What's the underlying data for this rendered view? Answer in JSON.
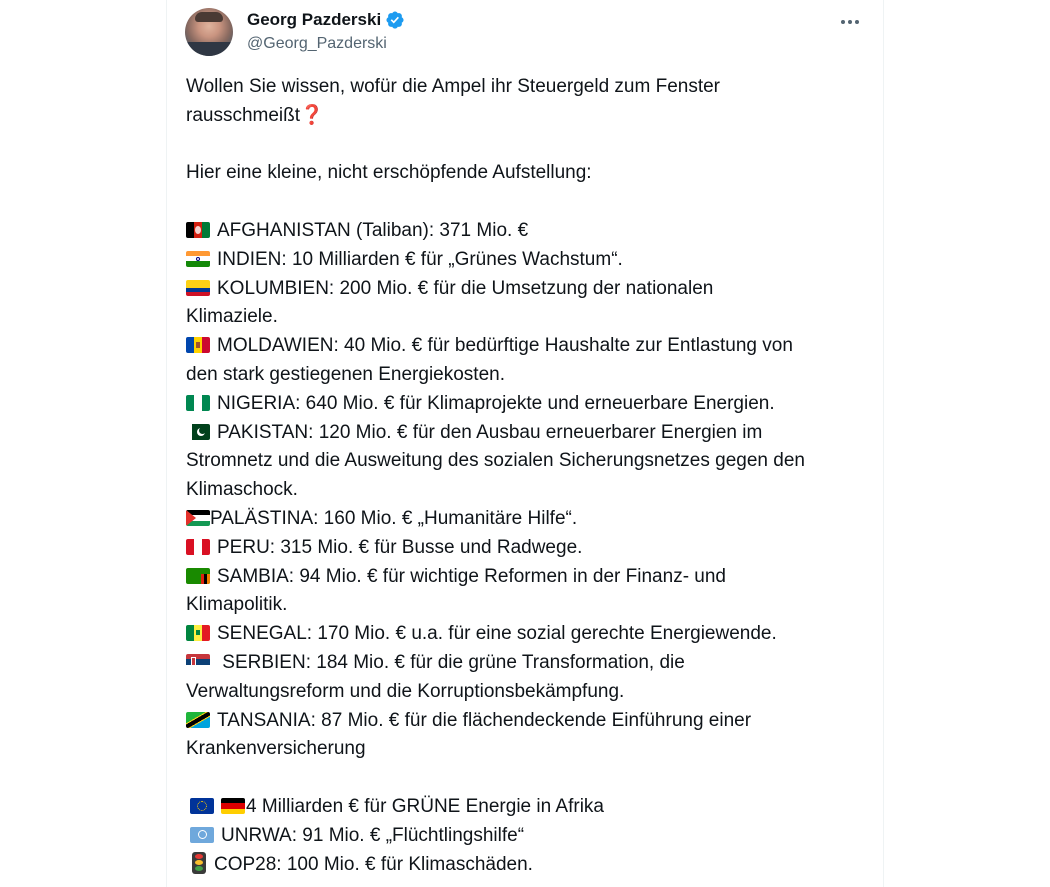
{
  "author": {
    "display_name": "Georg Pazderski",
    "handle": "@Georg_Pazderski"
  },
  "icons": {
    "verified": "verified-badge-icon",
    "more": "more-options-icon",
    "avatar": "avatar"
  },
  "colors": {
    "verified": "#1d9bf0",
    "text": "#0f1419",
    "muted": "#536471"
  },
  "tweet": {
    "intro_line1": "Wollen Sie wissen, wofür die Ampel ihr Steuergeld zum Fenster",
    "intro_line2": "rausschmeißt",
    "intro_emoji": "❓",
    "list_intro": "Hier eine kleine, nicht erschöpfende Aufstellung:",
    "entries": [
      {
        "flag": "afghanistan",
        "lines": [
          "AFGHANISTAN (Taliban): 371 Mio. €"
        ]
      },
      {
        "flag": "india",
        "lines": [
          "INDIEN: 10 Milliarden € für „Grünes Wachstum“."
        ]
      },
      {
        "flag": "colombia",
        "lines": [
          "KOLUMBIEN: 200 Mio. € für die Umsetzung der nationalen",
          "Klimaziele."
        ]
      },
      {
        "flag": "moldova",
        "lines": [
          "MOLDAWIEN: 40 Mio. € für bedürftige Haushalte zur Entlastung von",
          "den stark gestiegenen Energiekosten."
        ]
      },
      {
        "flag": "nigeria",
        "lines": [
          "NIGERIA: 640 Mio. € für Klimaprojekte und erneuerbare Energien."
        ]
      },
      {
        "flag": "pakistan",
        "lines": [
          "PAKISTAN: 120 Mio. € für den Ausbau erneuerbarer Energien im",
          "Stromnetz und die Ausweitung des sozialen Sicherungsnetzes gegen den",
          "Klimaschock."
        ]
      },
      {
        "flag": "palestine",
        "lines": [
          "PALÄSTINA: 160 Mio. € „Humanitäre Hilfe“."
        ]
      },
      {
        "flag": "peru",
        "lines": [
          "PERU: 315 Mio. € für Busse und Radwege."
        ]
      },
      {
        "flag": "zambia",
        "lines": [
          "SAMBIA: 94 Mio. € für wichtige Reformen in der Finanz- und",
          "Klimapolitik."
        ]
      },
      {
        "flag": "senegal",
        "lines": [
          "SENEGAL: 170 Mio. € u.a. für eine sozial gerechte Energiewende."
        ]
      },
      {
        "flag": "serbia",
        "lines": [
          " SERBIEN: 184 Mio. € für die grüne Transformation, die",
          "Verwaltungsreform und die Korruptionsbekämpfung."
        ]
      },
      {
        "flag": "tanzania",
        "lines": [
          "TANSANIA: 87 Mio. € für die flächendeckende Einführung einer",
          "Krankenversicherung"
        ]
      }
    ],
    "footer_entries": [
      {
        "icons": [
          "eu",
          "germany"
        ],
        "text": "4 Milliarden € für GRÜNE Energie in Afrika"
      },
      {
        "icons": [
          "un"
        ],
        "text": "UNRWA: 91 Mio. € „Flüchtlingshilfe“"
      },
      {
        "icons": [
          "traffic-light"
        ],
        "text": "COP28: 100 Mio. € für Klimaschäden."
      }
    ]
  }
}
